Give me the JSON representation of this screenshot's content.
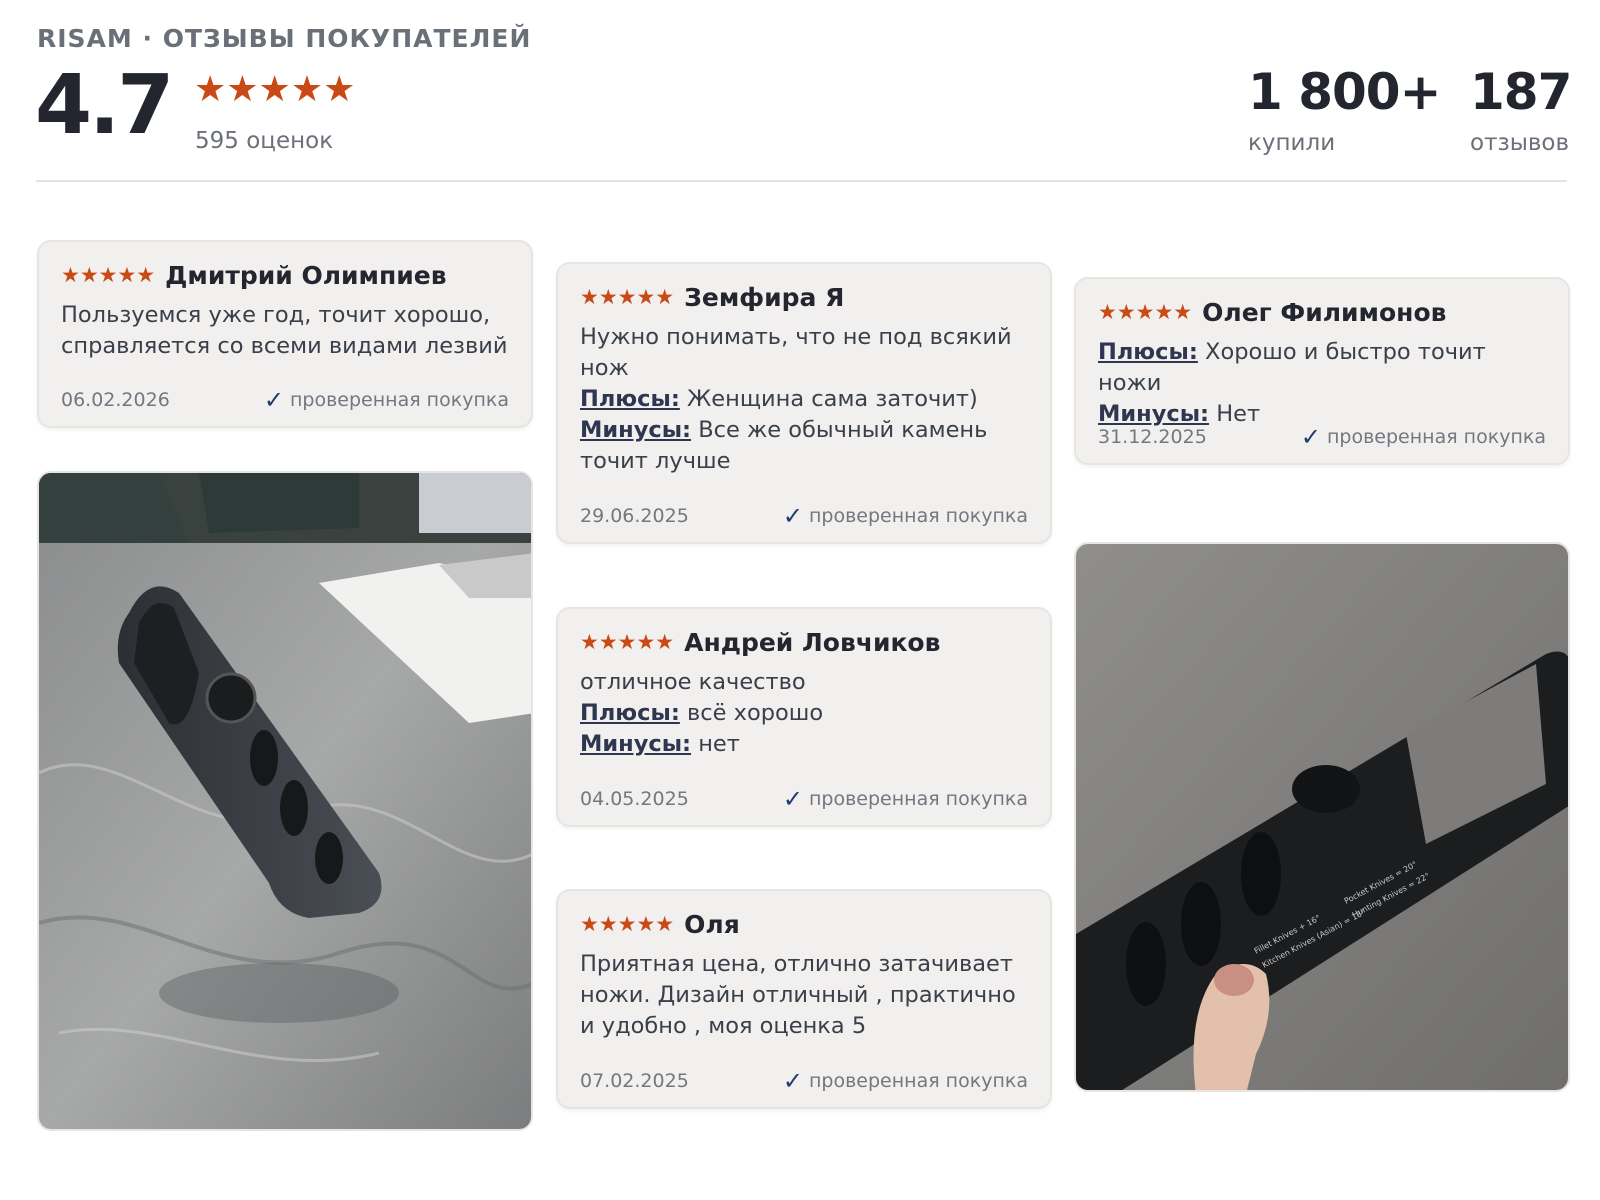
{
  "header": {
    "brand": "RISAM · ОТЗЫВЫ ПОКУПАТЕЛЕЙ",
    "rating": "4.7",
    "rating_stars": "★★★★★",
    "ratings_count": "595 оценок",
    "bought_value": "1 800+",
    "bought_label": "купили",
    "reviews_value": "187",
    "reviews_label": "отзывов"
  },
  "reviews": [
    {
      "stars": "★★★★★",
      "author": "Дмитрий Олимпиев",
      "text": "Пользуемся уже год, точит хорошо, справляется со всеми видами лезвий",
      "date": "06.02.2026",
      "verified": "проверенная покупка"
    },
    {
      "stars": "★★★★★",
      "author": "Земфира Я",
      "text": "Нужно понимать, что не под всякий нож",
      "pros_label": "Плюсы:",
      "pros": " Женщина сама заточит)",
      "cons_label": "Минусы:",
      "cons": " Все же обычный камень точит лучше",
      "date": "29.06.2025",
      "verified": "проверенная покупка"
    },
    {
      "stars": "★★★★★",
      "author": "Олег Филимонов",
      "pros_label": "Плюсы:",
      "pros": " Хорошо и быстро точит ножи",
      "cons_label": "Минусы:",
      "cons": " Нет",
      "date": "31.12.2025",
      "verified": "проверенная покупка"
    },
    {
      "stars": "★★★★★",
      "author": "Андрей Ловчиков",
      "text": "отличное качество",
      "pros_label": "Плюсы:",
      "pros": " всё хорошо",
      "cons_label": "Минусы:",
      "cons": " нет",
      "date": "04.05.2025",
      "verified": "проверенная покупка"
    },
    {
      "stars": "★★★★★",
      "author": "Оля",
      "text": "Приятная цена, отлично затачивает ножи. Дизайн отличный , практично и удобно , моя оценка 5",
      "date": "07.02.2025",
      "verified": "проверенная покупка"
    }
  ],
  "photos": [
    {
      "alt": "knife-sharpener-on-marble-table"
    },
    {
      "alt": "knife-sharpener-in-hand"
    }
  ],
  "colors": {
    "accent_star": "#c94a16",
    "card_bg": "#f1f0ee",
    "verified_check": "#1f3b6f"
  }
}
